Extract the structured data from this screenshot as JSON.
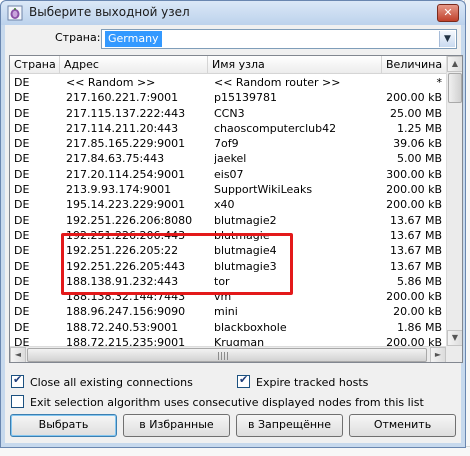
{
  "window": {
    "title": "Выберите выходной узел",
    "close_glyph": "✕"
  },
  "country": {
    "label": "Страна:",
    "selected": "Germany",
    "arrow_glyph": "▼"
  },
  "table": {
    "columns": [
      "Страна",
      "Адрес",
      "Имя узла",
      "Величина"
    ],
    "rows": [
      [
        "DE",
        "<< Random >>",
        "<< Random router >>",
        "*"
      ],
      [
        "DE",
        "217.160.221.7:9001",
        "p15139781",
        "200.00 kB"
      ],
      [
        "DE",
        "217.115.137.222:443",
        "CCN3",
        "25.00 MB"
      ],
      [
        "DE",
        "217.114.211.20:443",
        "chaoscomputerclub42",
        "1.25 MB"
      ],
      [
        "DE",
        "217.85.165.229:9001",
        "7of9",
        "39.06 kB"
      ],
      [
        "DE",
        "217.84.63.75:443",
        "jaekel",
        "5.00 MB"
      ],
      [
        "DE",
        "217.20.114.254:9001",
        "eis07",
        "300.00 kB"
      ],
      [
        "DE",
        "213.9.93.174:9001",
        "SupportWikiLeaks",
        "200.00 kB"
      ],
      [
        "DE",
        "195.14.223.229:9001",
        "x40",
        "200.00 kB"
      ],
      [
        "DE",
        "192.251.226.206:8080",
        "blutmagie2",
        "13.67 MB"
      ],
      [
        "DE",
        "192.251.226.206:443",
        "blutmagie",
        "13.67 MB"
      ],
      [
        "DE",
        "192.251.226.205:22",
        "blutmagie4",
        "13.67 MB"
      ],
      [
        "DE",
        "192.251.226.205:443",
        "blutmagie3",
        "13.67 MB"
      ],
      [
        "DE",
        "188.138.91.232:443",
        "tor",
        "5.86 MB"
      ],
      [
        "DE",
        "188.138.32.144:7443",
        "vm",
        "200.00 kB"
      ],
      [
        "DE",
        "188.96.247.156:9090",
        "mini",
        "20.00 kB"
      ],
      [
        "DE",
        "188.72.240.53:9001",
        "blackboxhole",
        "1.86 MB"
      ],
      [
        "DE",
        "188.72.215.235:9001",
        "Krugman",
        "200.00 kB"
      ]
    ],
    "scroll_up_glyph": "▲",
    "scroll_down_glyph": "▼",
    "scroll_left_glyph": "◄",
    "scroll_right_glyph": "►"
  },
  "options": {
    "close_connections": {
      "label": "Close all existing connections",
      "checked": true
    },
    "expire_hosts": {
      "label": "Expire tracked hosts",
      "checked": true
    },
    "exit_algorithm": {
      "label": "Exit selection algorithm uses consecutive displayed nodes from this list",
      "checked": false
    }
  },
  "buttons": {
    "select": "Выбрать",
    "favorites": "в Избранные",
    "blocked": "в Запрещённе",
    "cancel": "Отменить"
  },
  "colors": {
    "highlight_border": "#e3191a",
    "selection": "#3399ff",
    "titlebar": "#c7d9ed"
  }
}
